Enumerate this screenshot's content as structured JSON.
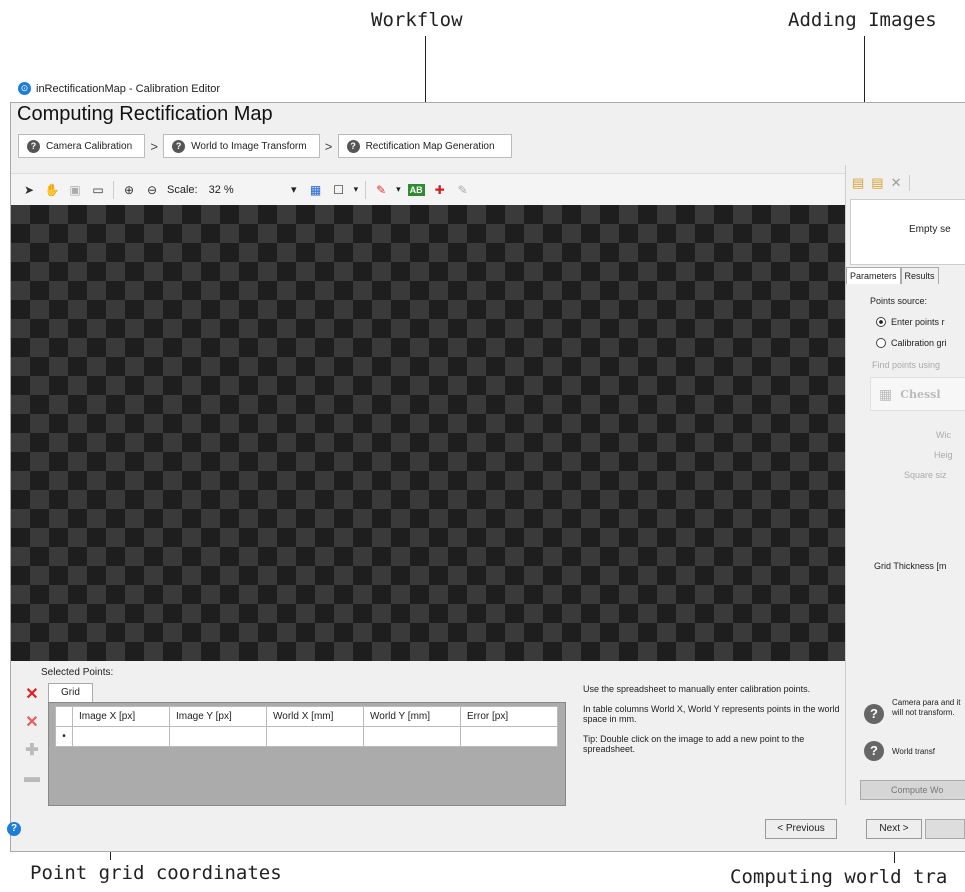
{
  "callouts": {
    "workflow": "Workflow",
    "adding_images": "Adding Images",
    "point_grid": "Point grid coordinates",
    "computing_world": "Computing world tra"
  },
  "window": {
    "title": "inRectificationMap - Calibration Editor",
    "heading": "Computing Rectification Map"
  },
  "steps": [
    {
      "label": "Camera Calibration"
    },
    {
      "label": "World to Image Transform"
    },
    {
      "label": "Rectification Map Generation"
    }
  ],
  "toolbar": {
    "scale_label": "Scale:",
    "scale_value": "32 %",
    "ab_label": "AB"
  },
  "bottom": {
    "selected_points_label": "Selected Points:",
    "grid_tab": "Grid",
    "columns": [
      "Image X [px]",
      "Image Y [px]",
      "World X [mm]",
      "World Y [mm]",
      "Error [px]"
    ],
    "row_marker": "•",
    "hint1": "Use the spreadsheet to manually enter calibration points.",
    "hint2": "In table columns World X, World Y represents points in the world space in mm.",
    "hint3": "Tip: Double click on the image to add a new point to the spreadsheet.",
    "prev_button": "< Previous",
    "next_button": "Next >"
  },
  "right_panel": {
    "empty_text": "Empty se",
    "tab_parameters": "Parameters",
    "tab_results": "Results",
    "points_source": "Points source:",
    "radio_enter": "Enter points r",
    "radio_grid": "Calibration gri",
    "find_points": "Find points using",
    "chess_label": "Chessl",
    "width_label": "Wic",
    "height_label": "Heig",
    "square_label": "Square siz",
    "grid_thickness": "Grid Thickness [m",
    "info1": "Camera para and it will not transform.",
    "info2": "World transf",
    "compute_button": "Compute Wo"
  }
}
